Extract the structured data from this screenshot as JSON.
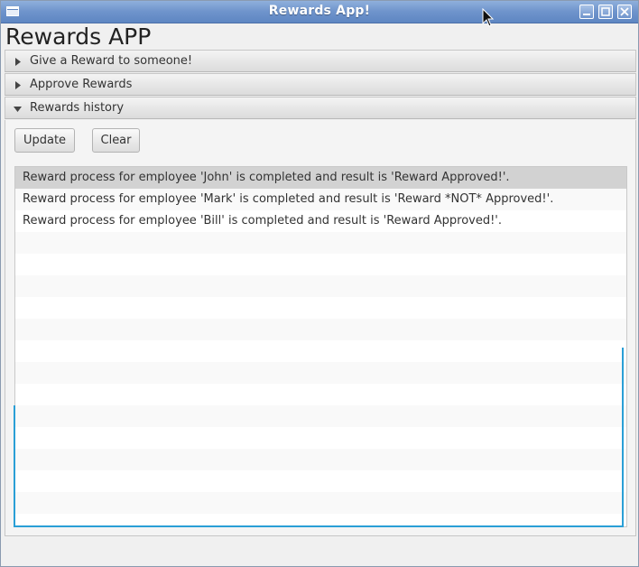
{
  "window": {
    "title": "Rewards App!"
  },
  "app": {
    "heading": "Rewards APP"
  },
  "accordion": {
    "panels": [
      {
        "label": "Give a Reward to someone!",
        "expanded": false
      },
      {
        "label": "Approve Rewards",
        "expanded": false
      },
      {
        "label": "Rewards history",
        "expanded": true
      }
    ]
  },
  "history": {
    "update_label": "Update",
    "clear_label": "Clear",
    "items": [
      "Reward process for employee 'John' is completed and result is 'Reward Approved!'.",
      "Reward process for employee 'Mark' is completed and result is 'Reward *NOT* Approved!'.",
      "Reward process for employee 'Bill' is completed and result is 'Reward Approved!'."
    ],
    "selected_index": 0
  },
  "colors": {
    "titlebar": "#6f94cc",
    "focus": "#2a9fd6",
    "selected_row": "#d2d2d2"
  },
  "icons": {
    "window": "app-icon",
    "collapsed": "triangle-right-icon",
    "expanded": "triangle-down-icon",
    "minimize": "minimize-icon",
    "maximize": "maximize-icon",
    "close": "close-icon"
  }
}
